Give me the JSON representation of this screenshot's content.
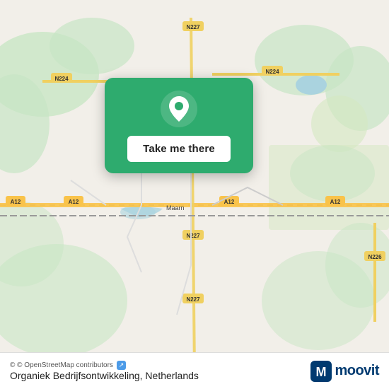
{
  "map": {
    "attribution": "© OpenStreetMap contributors",
    "location_name": "Organiek Bedrijfsontwikkeling, Netherlands"
  },
  "popup": {
    "button_label": "Take me there"
  },
  "branding": {
    "moovit_label": "moovit"
  },
  "colors": {
    "popup_bg": "#2eab6e",
    "button_bg": "#ffffff",
    "map_bg": "#f2efe9"
  }
}
